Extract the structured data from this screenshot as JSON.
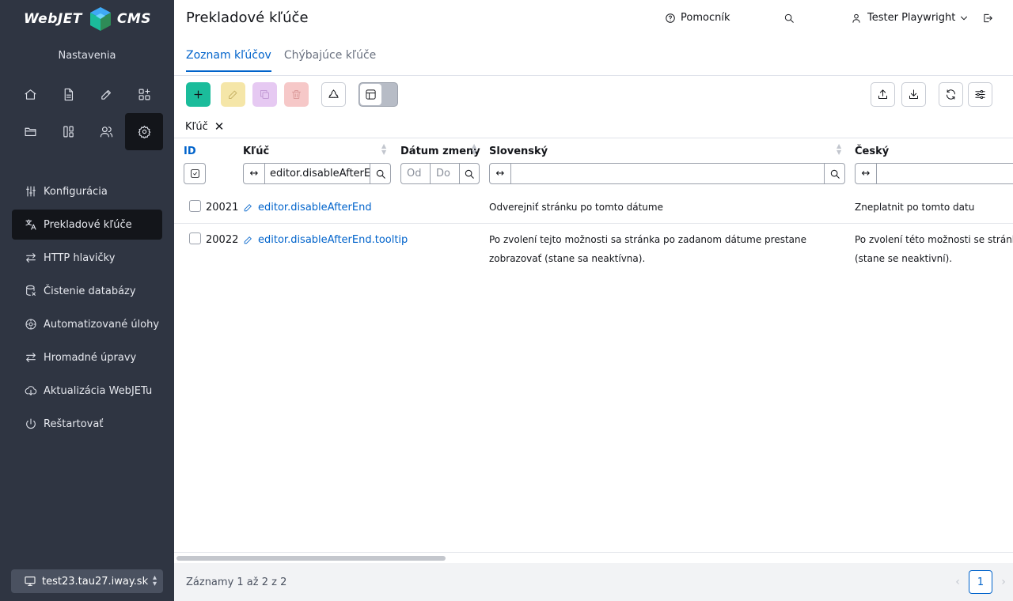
{
  "sidebar": {
    "logo_left": "WebJET",
    "logo_right": "CMS",
    "section_title": "Nastavenia",
    "menu": [
      {
        "label": "Konfigurácia",
        "icon": "sliders-icon"
      },
      {
        "label": "Prekladové kľúče",
        "icon": "translate-icon",
        "active": true
      },
      {
        "label": "HTTP hlavičky",
        "icon": "arrows-swap-icon"
      },
      {
        "label": "Čistenie databázy",
        "icon": "database-clean-icon"
      },
      {
        "label": "Automatizované úlohy",
        "icon": "automation-icon"
      },
      {
        "label": "Hromadné úpravy",
        "icon": "arrows-swap-icon"
      },
      {
        "label": "Aktualizácia WebJETu",
        "icon": "cloud-download-icon"
      },
      {
        "label": "Reštartovať",
        "icon": "power-icon"
      }
    ],
    "domain": "test23.tau27.iway.sk"
  },
  "header": {
    "title": "Prekladové kľúče",
    "help": "Pomocník",
    "user": "Tester Playwright",
    "tabs": [
      "Zoznam kľúčov",
      "Chýbajúce kľúče"
    ]
  },
  "filter_chip": {
    "label": "Kľúč"
  },
  "table": {
    "columns": {
      "id": "ID",
      "key": "Kľúč",
      "date": "Dátum zmeny",
      "sk": "Slovenský",
      "cz": "Český"
    },
    "filters": {
      "key_value": "editor.disableAfterEnd",
      "date_from": "Od",
      "date_to": "Do"
    },
    "rows": [
      {
        "id": "20021",
        "key": "editor.disableAfterEnd",
        "sk": "Odverejniť stránku po tomto dátume",
        "cz": "Zneplatnit po tomto datu"
      },
      {
        "id": "20022",
        "key": "editor.disableAfterEnd.tooltip",
        "sk": "Po zvolení tejto možnosti sa stránka po zadanom dátume prestane zobrazovať (stane sa neaktívna).",
        "cz": "Po zvolení této možnosti se stránka",
        "cz2": "(stane se neaktivní)."
      }
    ]
  },
  "footer": {
    "info": "Záznamy 1 až 2 z 2",
    "page": "1"
  },
  "colors": {
    "accent": "#0063cb",
    "sidebar": "#2f3542",
    "add_button": "#1bbc9b"
  }
}
